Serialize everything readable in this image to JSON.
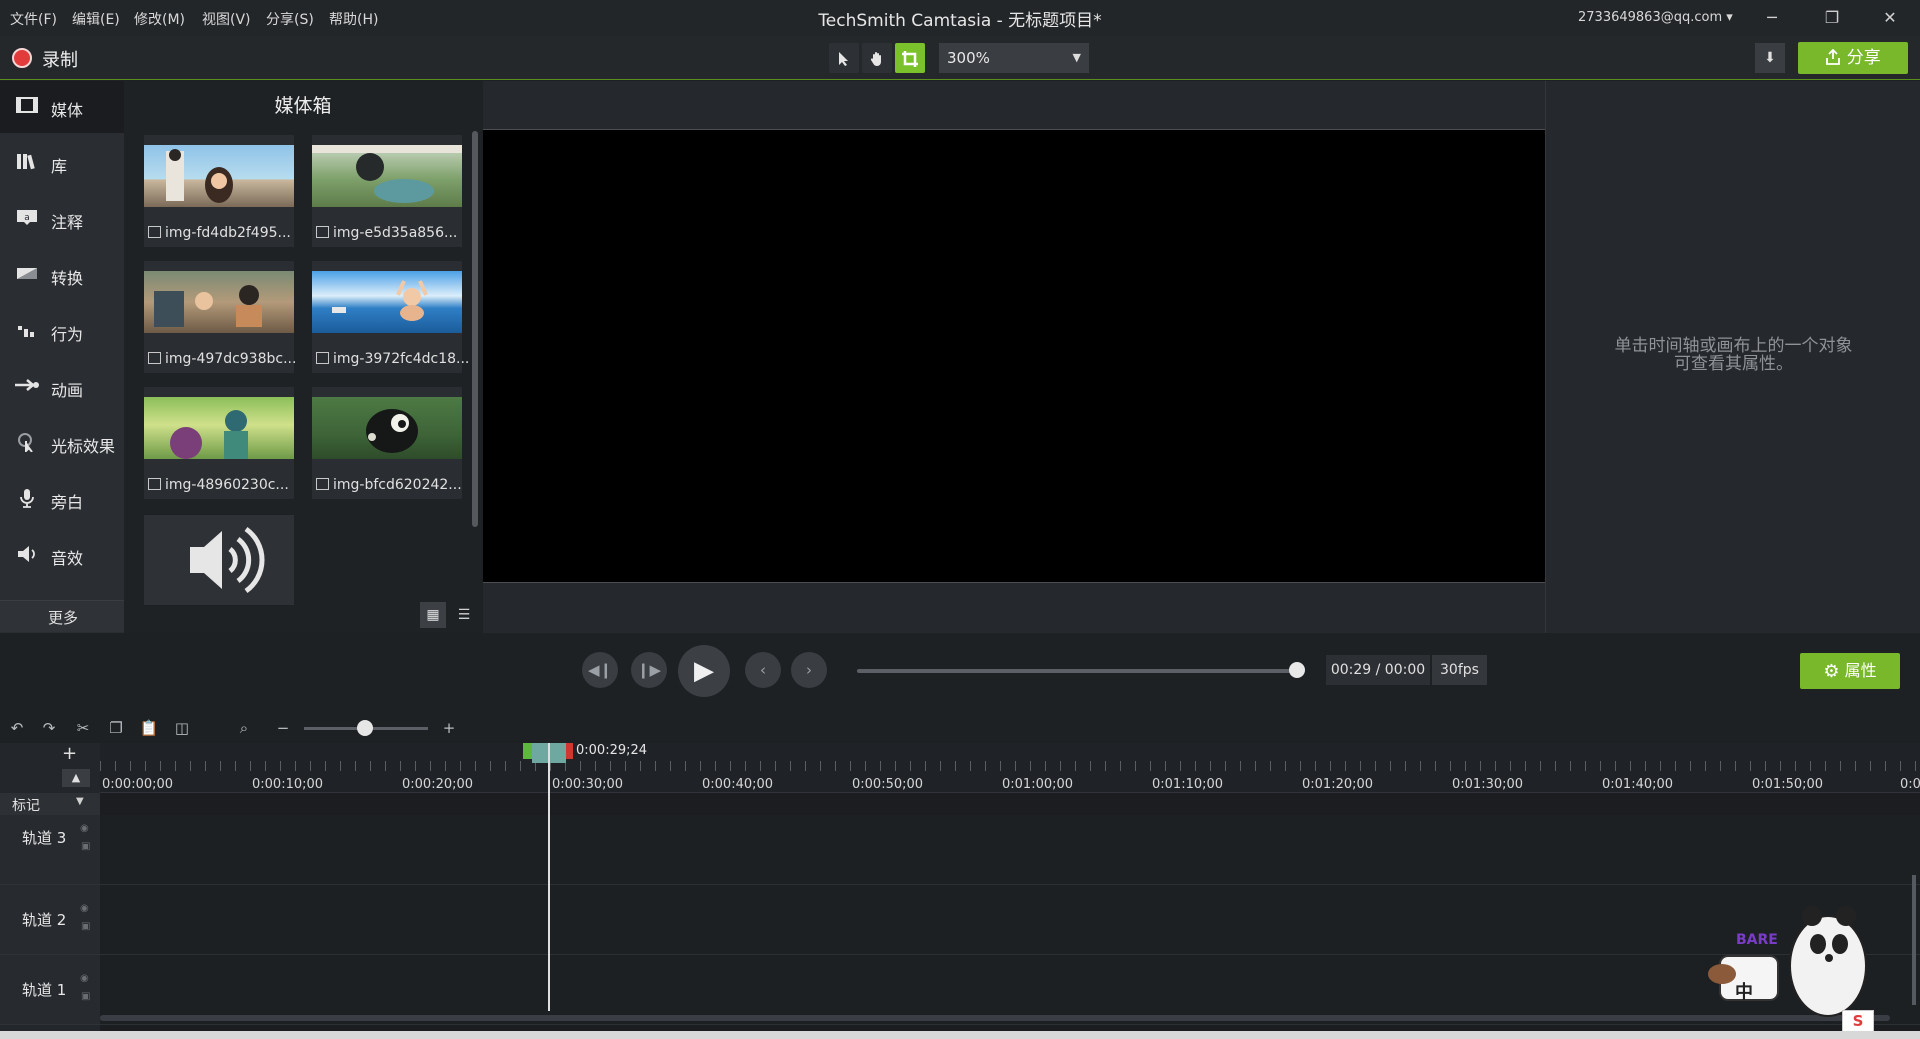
{
  "menubar": {
    "items": [
      "文件(F)",
      "编辑(E)",
      "修改(M)",
      "视图(V)",
      "分享(S)",
      "帮助(H)"
    ],
    "title": "TechSmith Camtasia - 无标题项目*",
    "account": "2733649863@qq.com ▾",
    "minimize": "─",
    "restore": "❐",
    "close": "✕"
  },
  "toolbar": {
    "record_label": "录制",
    "zoom_value": "300%",
    "share_label": "分享",
    "accent": "#78b82a"
  },
  "leftnav": {
    "items": [
      {
        "label": "媒体",
        "icon": "film-icon"
      },
      {
        "label": "库",
        "icon": "library-icon"
      },
      {
        "label": "注释",
        "icon": "annotation-icon"
      },
      {
        "label": "转换",
        "icon": "transition-icon"
      },
      {
        "label": "行为",
        "icon": "behavior-icon"
      },
      {
        "label": "动画",
        "icon": "animation-icon"
      },
      {
        "label": "光标效果",
        "icon": "cursor-effect-icon"
      },
      {
        "label": "旁白",
        "icon": "microphone-icon"
      },
      {
        "label": "音效",
        "icon": "speaker-icon"
      }
    ],
    "more_label": "更多",
    "add_label": "+"
  },
  "mediabin": {
    "title": "媒体箱",
    "items": [
      {
        "label": "img-fd4db2f495..."
      },
      {
        "label": "img-e5d35a856..."
      },
      {
        "label": "img-497dc938bc..."
      },
      {
        "label": "img-3972fc4dc18..."
      },
      {
        "label": "img-48960230c..."
      },
      {
        "label": "img-bfcd620242..."
      }
    ]
  },
  "properties": {
    "hint_line1": "单击时间轴或画布上的一个对象",
    "hint_line2": "可查看其属性。",
    "button_label": "属性"
  },
  "playback": {
    "time": "00:29 / 00:00",
    "fps": "30fps",
    "progress": 1.0
  },
  "timeline": {
    "playhead_time": "0:00:29;24",
    "ticks": [
      "0:00:00;00",
      "0:00:10;00",
      "0:00:20;00",
      "0:00:30;00",
      "0:00:40;00",
      "0:00:50;00",
      "0:01:00;00",
      "0:01:10;00",
      "0:01:20;00",
      "0:01:30;00",
      "0:01:40;00",
      "0:01:50;00",
      "0:0"
    ],
    "markers_label": "标记",
    "tracks": [
      "轨道 3",
      "轨道 2",
      "轨道 1"
    ],
    "zoom_minus": "−",
    "zoom_plus": "+",
    "add_track": "+"
  },
  "ime": {
    "badge": "中",
    "logo_text": "We BARE BEARS"
  }
}
